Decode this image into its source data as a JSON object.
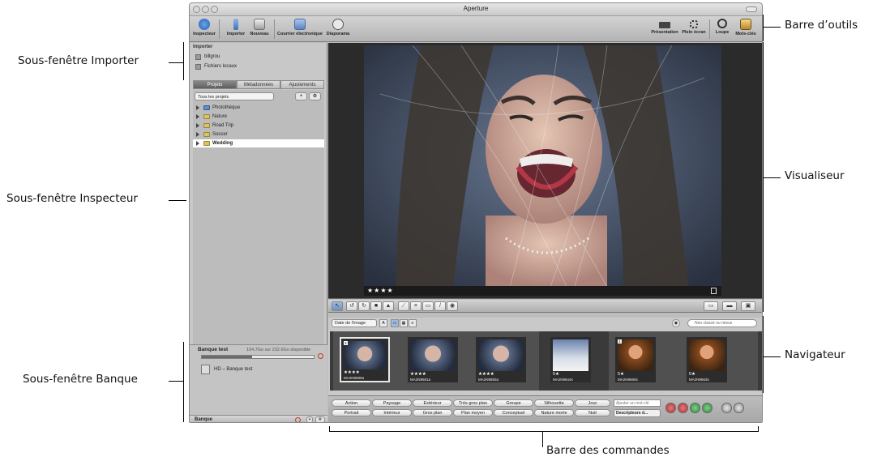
{
  "window": {
    "title": "Aperture"
  },
  "toolbar": {
    "left": [
      {
        "label": "Inspecteur",
        "icon": "info-icon"
      },
      {
        "label": "Importer",
        "icon": "import-arrow-icon"
      },
      {
        "label": "Nouveau",
        "icon": "new-project-icon"
      },
      {
        "label": "Courrier électronique",
        "icon": "email-icon"
      },
      {
        "label": "Diaporama",
        "icon": "play-icon"
      }
    ],
    "right": [
      {
        "label": "Présentation",
        "icon": "presentation-icon"
      },
      {
        "label": "Plein écran",
        "icon": "fullscreen-icon"
      },
      {
        "label": "Loupe",
        "icon": "loupe-icon"
      },
      {
        "label": "Mots-clés",
        "icon": "keywords-icon"
      }
    ]
  },
  "importer": {
    "title": "Importer",
    "items": [
      "billgrou",
      "Fichiers locaux"
    ]
  },
  "inspector": {
    "tabs": [
      "Projets",
      "Métadonnées",
      "Ajustements"
    ],
    "active_tab": "Projets",
    "filter": "Tous les projets",
    "projects": [
      {
        "label": "Photothèque",
        "selected": false
      },
      {
        "label": "Nature",
        "selected": false
      },
      {
        "label": "Road Trip",
        "selected": false
      },
      {
        "label": "Soccer",
        "selected": false
      },
      {
        "label": "Wedding",
        "selected": true
      }
    ]
  },
  "vault": {
    "title": "Banque test",
    "space": "104.7Go sur 232.6Go disponible",
    "used_fraction": 0.45,
    "item": "HD – Banque test",
    "footer": "Banque"
  },
  "viewer": {
    "rating": "★★★★"
  },
  "browser": {
    "sort": "Date de l'image",
    "sort_direction": "A",
    "search_placeholder": "Non classé ou mieux",
    "thumbnails": [
      {
        "name": "MA2N9580a",
        "stars": "★★★★",
        "num": "3",
        "selected": true
      },
      {
        "name": "MA2N9581a",
        "stars": "★★★★",
        "num": "",
        "selected": false
      },
      {
        "name": "MA2N9583a",
        "stars": "★★★★",
        "num": "",
        "selected": false
      },
      {
        "name": "MA2N9644s",
        "stars": "5★",
        "num": "",
        "selected": false
      },
      {
        "name": "MA2N9660s",
        "stars": "5★",
        "num": "3",
        "selected": false
      },
      {
        "name": "MA2N9663s",
        "stars": "5★",
        "num": "",
        "selected": false
      }
    ]
  },
  "control_bar": {
    "keywords_row1": [
      "Action",
      "Paysage",
      "Extérieur",
      "Très gros plan",
      "Groupe",
      "Silhouette",
      "Jour"
    ],
    "keywords_row2": [
      "Portrait",
      "Intérieur",
      "Gros plan",
      "Plan moyen",
      "Conceptuel",
      "Nature morte",
      "Nuit"
    ],
    "keyword_input_placeholder": "Ajouter un mot-clé",
    "descriptors": "Descripteurs d..."
  },
  "callouts": {
    "toolbar": "Barre d’outils",
    "import_pane": "Sous-fenêtre Importer",
    "viewer": "Visualiseur",
    "inspector_pane": "Sous-fenêtre Inspecteur",
    "browser": "Navigateur",
    "vault_pane": "Sous-fenêtre Banque",
    "control_bar": "Barre des commandes"
  },
  "colors": {
    "selection_blue": "#6f8fbf",
    "reject_red": "#c0392b",
    "approve_green": "#3ea34a"
  }
}
